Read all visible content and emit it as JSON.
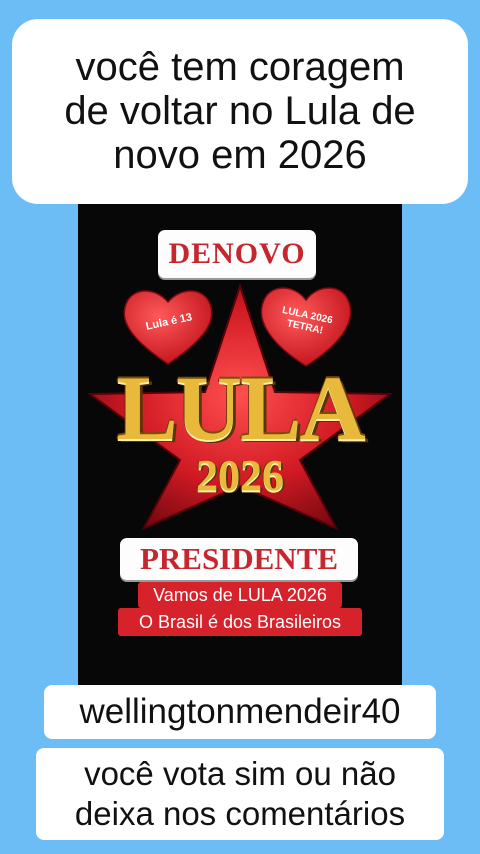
{
  "caption": {
    "lines": [
      "você tem coragem",
      "de voltar no Lula de",
      "novo em 2026"
    ]
  },
  "poster": {
    "top_label": "DENOVO",
    "heart_left": "Lula é 13",
    "heart_right_line1": "LULA 2026",
    "heart_right_line2": "TETRA!",
    "main_title": "LULA",
    "year": "2026",
    "role": "PRESIDENTE",
    "slogan1": "Vamos de LULA 2026",
    "slogan2": "O Brasil é dos Brasileiros"
  },
  "username": "wellingtonmendeir40",
  "question": {
    "lines": [
      "você vota sim ou não",
      "deixa nos comentários"
    ]
  },
  "colors": {
    "background": "#6cbcf6",
    "poster_bg": "#070707",
    "accent_red": "#d6232b",
    "gold": "#e8b93a"
  }
}
